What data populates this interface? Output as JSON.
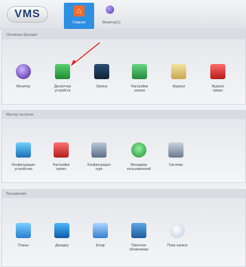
{
  "header": {
    "logo": "VMS",
    "tabs": [
      {
        "label": "Главная"
      },
      {
        "label": "Монитор(1)"
      }
    ]
  },
  "sections": [
    {
      "title": "Основные функции",
      "items": [
        {
          "label": "Монитор",
          "icon": "monitor-icon"
        },
        {
          "label": "Диспетчер\nустройств",
          "icon": "device-manager-icon"
        },
        {
          "label": "Записи",
          "icon": "records-icon"
        },
        {
          "label": "Настройки\nзаписи",
          "icon": "record-settings-icon"
        },
        {
          "label": "Журнал",
          "icon": "log-icon"
        },
        {
          "label": "Журнал\nтревог",
          "icon": "alarm-log-icon"
        }
      ]
    },
    {
      "title": "Мастер настроек",
      "items": [
        {
          "label": "Конфигурация\nустройства",
          "icon": "device-config-icon"
        },
        {
          "label": "Настройки\nтревог",
          "icon": "alarm-settings-icon"
        },
        {
          "label": "Конфигурация\nтура",
          "icon": "tour-config-icon"
        },
        {
          "label": "Менеджер\nпользователей",
          "icon": "user-manager-icon"
        },
        {
          "label": "Система",
          "icon": "system-gear-icon"
        }
      ]
    },
    {
      "title": "Расширения",
      "items": [
        {
          "label": "Планы",
          "icon": "plans-icon"
        },
        {
          "label": "Декодер",
          "icon": "decoder-icon"
        },
        {
          "label": "Emap",
          "icon": "emap-icon"
        },
        {
          "label": "Пакетное\nобновление",
          "icon": "batch-update-icon"
        },
        {
          "label": "План записи",
          "icon": "record-plan-icon"
        }
      ]
    }
  ]
}
